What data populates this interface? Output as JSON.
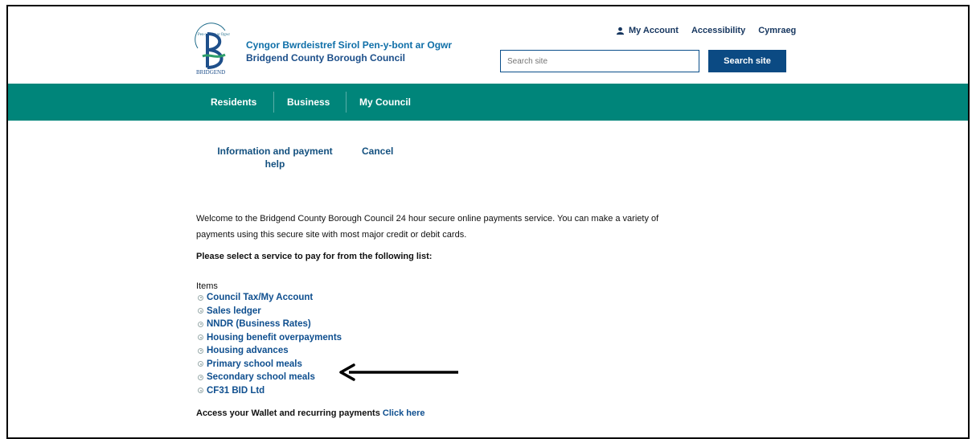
{
  "header": {
    "welsh_name": "Cyngor Bwrdeistref Sirol Pen-y-bont ar Ogwr",
    "english_name": "Bridgend County Borough Council",
    "logo_text": "BRIDGEND",
    "logo_arc_text": "Pen-y-bont ar Ogwr"
  },
  "top_links": {
    "account": "My Account",
    "accessibility": "Accessibility",
    "language": "Cymraeg"
  },
  "search": {
    "placeholder": "Search site",
    "button_label": "Search site"
  },
  "nav": {
    "items": [
      "Residents",
      "Business",
      "My Council"
    ]
  },
  "subnav": {
    "help": "Information and payment help",
    "cancel": "Cancel"
  },
  "content": {
    "welcome": "Welcome to the Bridgend County Borough Council 24 hour secure online payments service. You can make a variety of payments using this secure site with most major credit or debit cards.",
    "select_heading": "Please select a service to pay for from the following list:",
    "items_label": "Items",
    "items": [
      "Council Tax/My Account",
      "Sales ledger",
      "NNDR (Business Rates)",
      "Housing benefit overpayments",
      "Housing advances",
      "Primary school meals",
      "Secondary school meals",
      "CF31 BID Ltd"
    ],
    "wallet_text": "Access your Wallet and recurring payments",
    "wallet_link": "Click here"
  },
  "colors": {
    "teal_nav": "#00857a",
    "navy_button": "#0b4a83",
    "link_blue": "#0f4f8f"
  }
}
